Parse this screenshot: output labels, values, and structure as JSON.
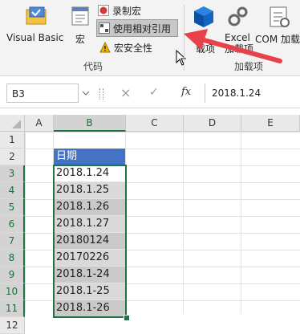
{
  "ribbon": {
    "visual_basic": "Visual Basic",
    "macros": "宏",
    "record_macro": "录制宏",
    "use_relative_refs": "使用相对引用",
    "macro_security": "宏安全性",
    "code_group": "代码",
    "addins_btn": "加\n载项",
    "excel_addins": "Excel\n加载项",
    "com_addins": "COM 加载",
    "addins_group": "加载项"
  },
  "formula_bar": {
    "name_box": "B3",
    "cancel": "×",
    "enter": "✓",
    "fx": "fx",
    "value": "2018.1.24"
  },
  "grid": {
    "columns": [
      "A",
      "B",
      "C",
      "D",
      "E"
    ],
    "rows": [
      "1",
      "2",
      "3",
      "4",
      "5",
      "6",
      "7",
      "8",
      "9",
      "10",
      "11",
      "12"
    ],
    "header_cell": "日期",
    "cells": [
      "2018.1.24",
      "2018.1.25",
      "2018.1.26",
      "2018.1.27",
      "20180124",
      "20170226",
      "2018.1-24",
      "2018.1-25",
      "2018.1-26"
    ]
  },
  "colors": {
    "accent_green": "#217346",
    "header_blue": "#4472c4",
    "arrow_red": "#e8414a"
  }
}
